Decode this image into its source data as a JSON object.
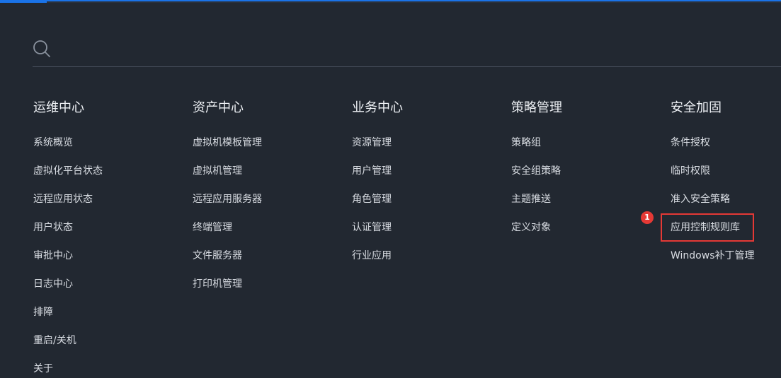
{
  "search": {
    "icon": "search-icon",
    "placeholder": "",
    "value": ""
  },
  "annotation": {
    "badge": "1",
    "color": "#e53935"
  },
  "colors": {
    "background": "#222831",
    "accent": "#1a73e8",
    "highlight": "#e53935"
  },
  "columns": [
    {
      "heading": "运维中心",
      "items": [
        "系统概览",
        "虚拟化平台状态",
        "远程应用状态",
        "用户状态",
        "审批中心",
        "日志中心",
        "排障",
        "重启/关机",
        "关于"
      ]
    },
    {
      "heading": "资产中心",
      "items": [
        "虚拟机模板管理",
        "虚拟机管理",
        "远程应用服务器",
        "终端管理",
        "文件服务器",
        "打印机管理"
      ]
    },
    {
      "heading": "业务中心",
      "items": [
        "资源管理",
        "用户管理",
        "角色管理",
        "认证管理",
        "行业应用"
      ]
    },
    {
      "heading": "策略管理",
      "items": [
        "策略组",
        "安全组策略",
        "主题推送",
        "定义对象"
      ]
    },
    {
      "heading": "安全加固",
      "items": [
        "条件授权",
        "临时权限",
        "准入安全策略",
        "应用控制规则库",
        "Windows补丁管理"
      ]
    }
  ]
}
